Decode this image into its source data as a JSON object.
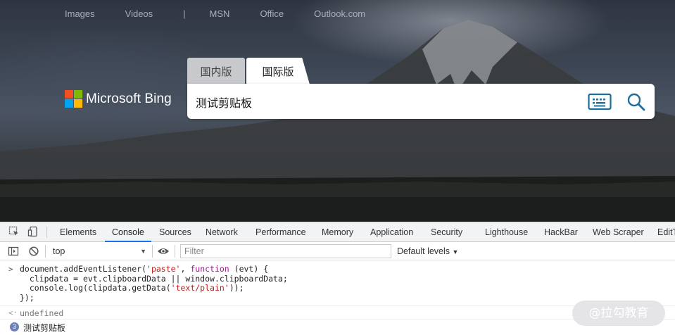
{
  "bing": {
    "nav_links": [
      "Images",
      "Videos",
      "|",
      "MSN",
      "Office",
      "Outlook.com"
    ],
    "logo_text": "Microsoft Bing",
    "tabs": [
      {
        "label": "国内版",
        "active": false
      },
      {
        "label": "国际版",
        "active": true
      }
    ],
    "search_query": "测试剪贴板",
    "icons": {
      "keyboard": "keyboard-icon",
      "search": "search-icon"
    },
    "logo_colors": [
      "#f25022",
      "#7fba00",
      "#00a4ef",
      "#ffb900"
    ]
  },
  "devtools": {
    "tabs": [
      "Elements",
      "Console",
      "Sources",
      "Network",
      "Performance",
      "Memory",
      "Application",
      "Security",
      "Lighthouse",
      "HackBar",
      "Web Scraper",
      "EditT"
    ],
    "active_tab": "Console",
    "context": "top",
    "filter_placeholder": "Filter",
    "levels": "Default levels",
    "console": {
      "input_lines": [
        "document.addEventListener('paste', function (evt) {",
        "  clipdata = evt.clipboardData || window.clipboardData;",
        "  console.log(clipdata.getData('text/plain'));",
        "});"
      ],
      "result": "undefined",
      "log_count": "3",
      "log_message": "测试剪贴板"
    },
    "accent_color": "#1a73e8"
  },
  "watermark": "@拉勾教育"
}
